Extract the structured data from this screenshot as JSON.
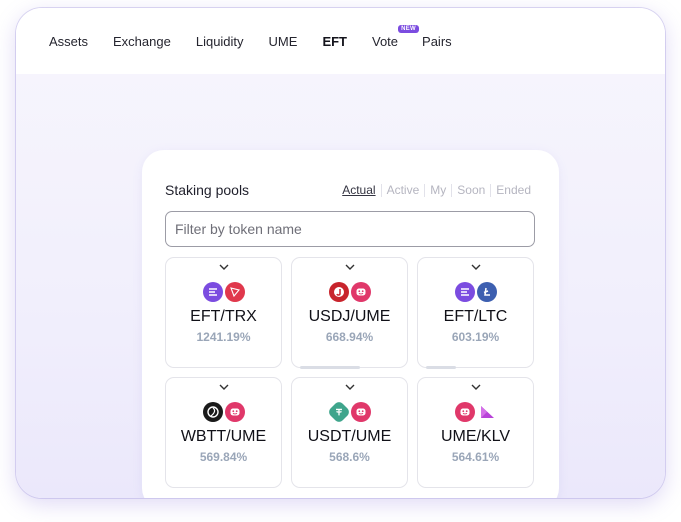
{
  "nav": {
    "items": [
      {
        "label": "Assets"
      },
      {
        "label": "Exchange"
      },
      {
        "label": "Liquidity"
      },
      {
        "label": "UME"
      },
      {
        "label": "EFT",
        "active": true
      },
      {
        "label": "Vote",
        "badge": "NEW"
      },
      {
        "label": "Pairs"
      }
    ]
  },
  "staking": {
    "title": "Staking pools",
    "filters": [
      "Actual",
      "Active",
      "My",
      "Soon",
      "Ended"
    ],
    "active_filter": "Actual",
    "search_placeholder": "Filter by token name",
    "pools": [
      {
        "pair": "EFT/TRX",
        "apy": "1241.19%",
        "tokens": [
          "eft-icon",
          "trx-icon"
        ]
      },
      {
        "pair": "USDJ/UME",
        "apy": "668.94%",
        "tokens": [
          "usdj-icon",
          "ume-icon"
        ]
      },
      {
        "pair": "EFT/LTC",
        "apy": "603.19%",
        "tokens": [
          "eft-icon",
          "ltc-icon"
        ]
      },
      {
        "pair": "WBTT/UME",
        "apy": "569.84%",
        "tokens": [
          "wbtt-icon",
          "ume-icon"
        ]
      },
      {
        "pair": "USDT/UME",
        "apy": "568.6%",
        "tokens": [
          "usdt-icon",
          "ume-icon"
        ]
      },
      {
        "pair": "UME/KLV",
        "apy": "564.61%",
        "tokens": [
          "ume-icon",
          "klv-icon"
        ]
      }
    ]
  },
  "colors": {
    "accent": "#7b4ce0",
    "eft": "#7b4ce0",
    "trx": "#e0384c",
    "usdj": "#c8242c",
    "ume": "#e0386a",
    "ltc": "#3d5fb0",
    "wbtt": "#1a1a1a",
    "usdt": "#3fa58c",
    "klv": "#b843d8",
    "apy_text": "#9aa6b8"
  }
}
